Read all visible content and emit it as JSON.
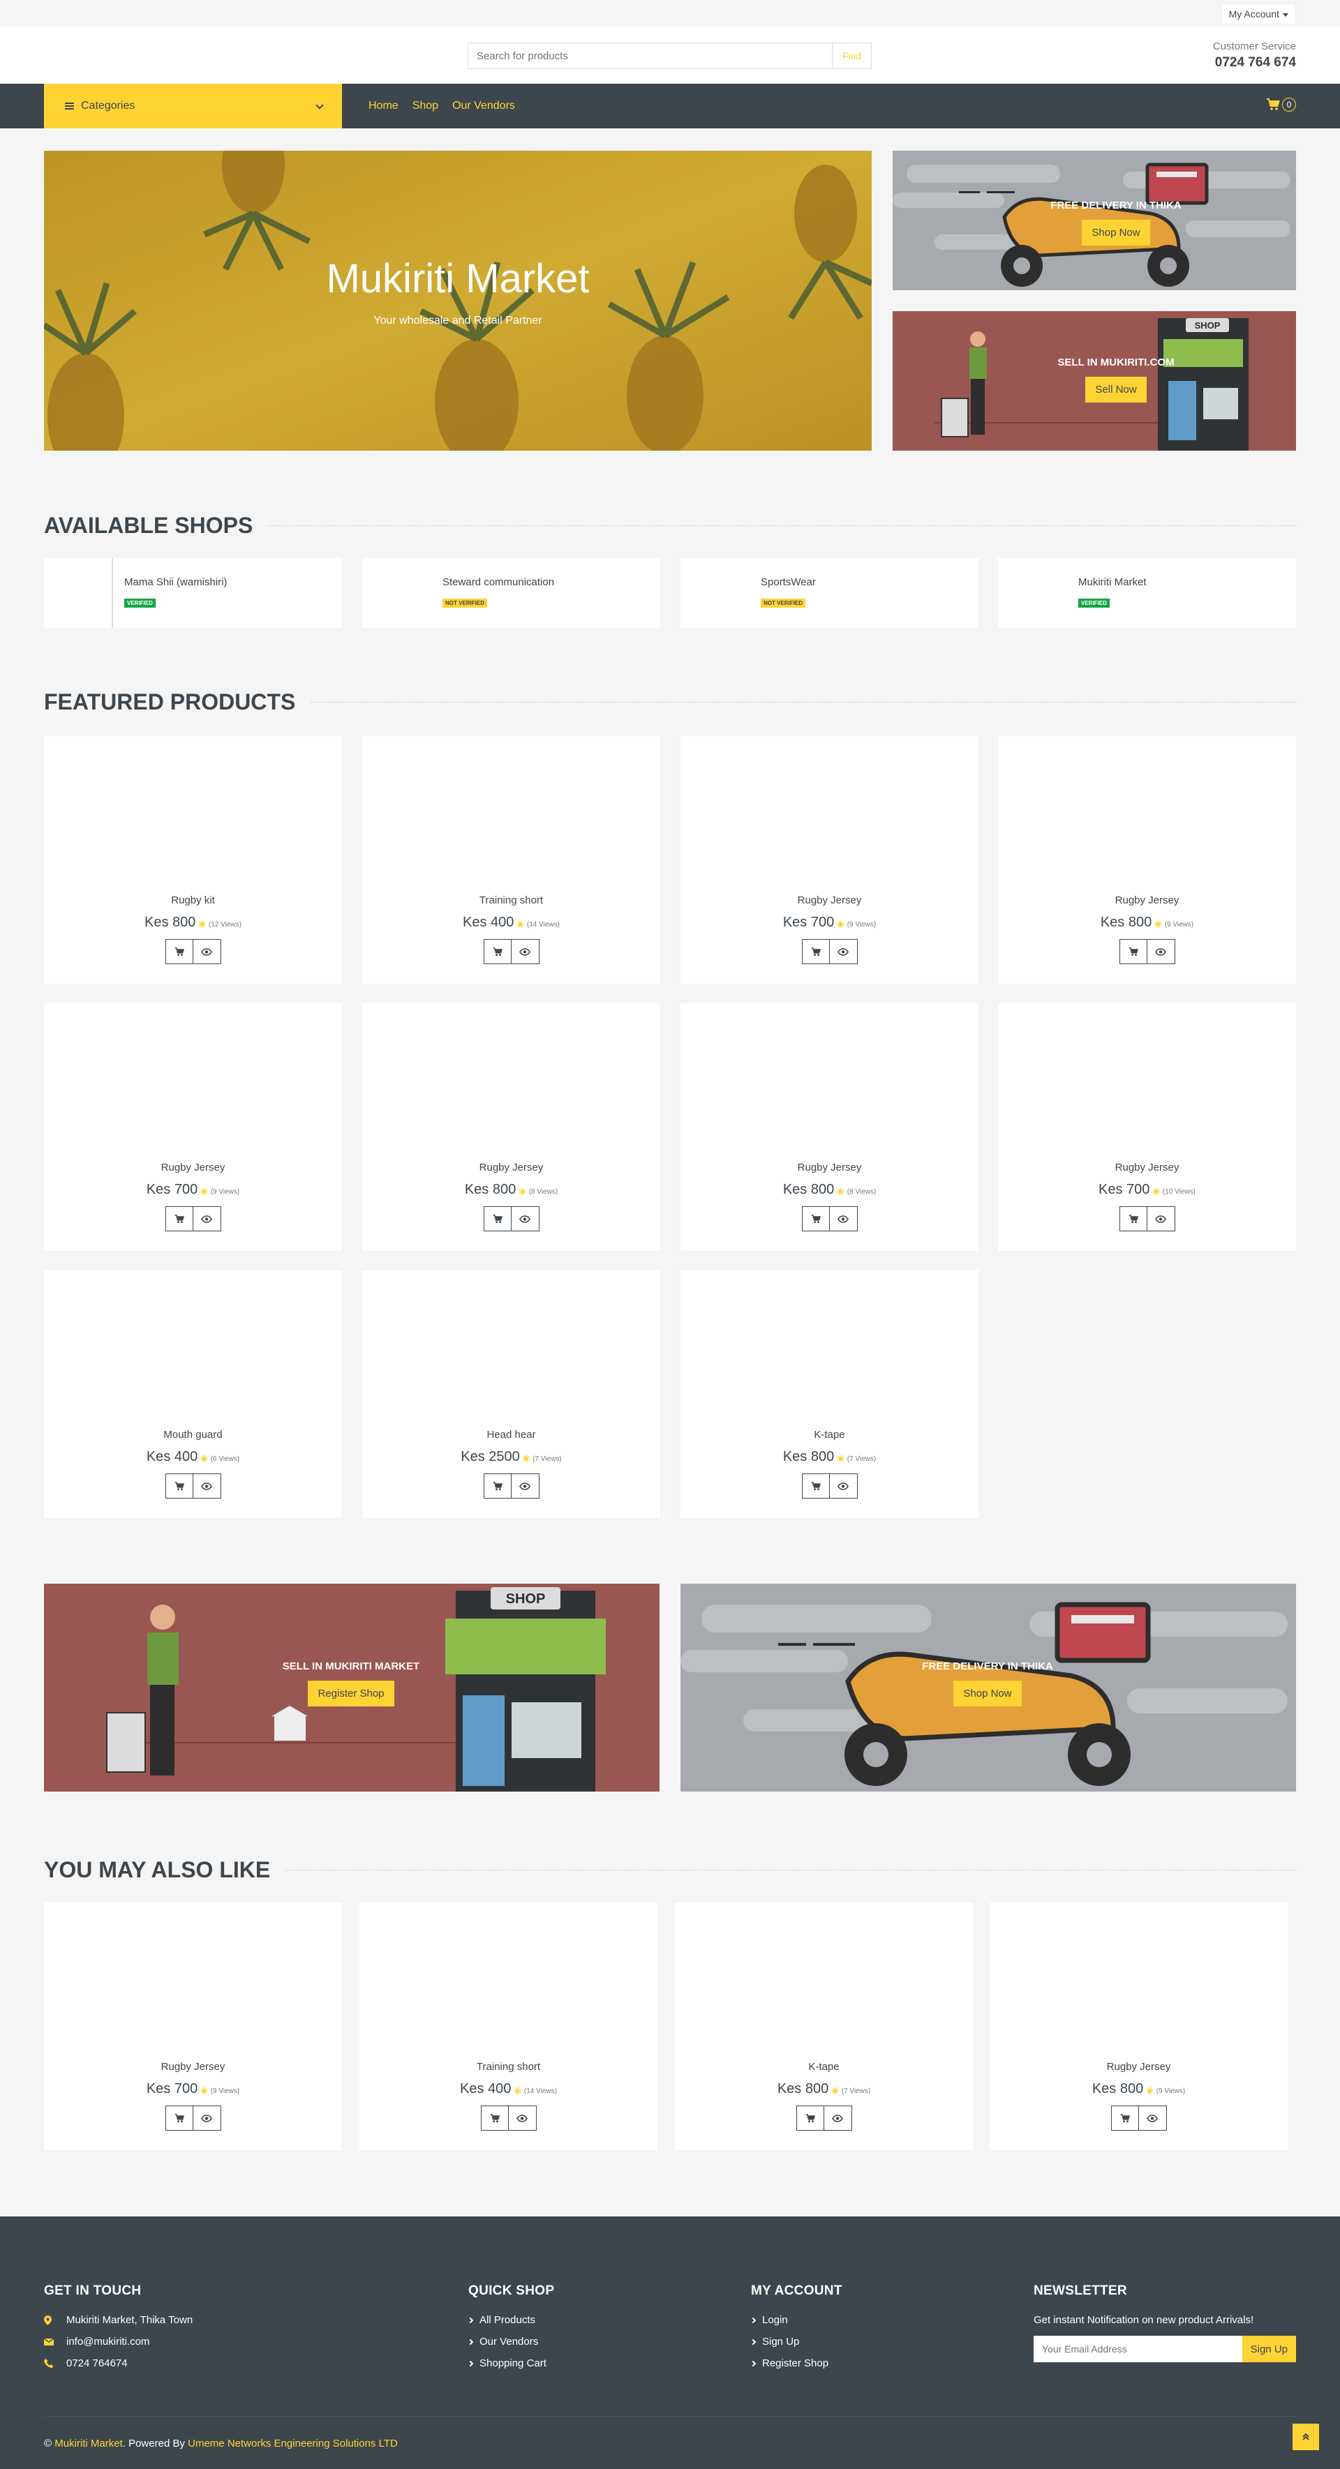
{
  "topbar": {
    "account_label": "My Account"
  },
  "header": {
    "search_placeholder": "Search for products",
    "search_button": "Find",
    "cs_label": "Customer Service",
    "cs_phone": "0724 764 674"
  },
  "nav": {
    "categories_label": "Categories",
    "links": [
      "Home",
      "Shop",
      "Our Vendors"
    ],
    "cart_count": "0"
  },
  "hero": {
    "title": "Mukiriti Market",
    "subtitle": "Your wholesale and Retail Partner"
  },
  "promos": [
    {
      "title": "FREE DELIVERY IN THIKA",
      "button": "Shop Now"
    },
    {
      "title": "SELL IN MUKIRITI.COM",
      "button": "Sell Now"
    }
  ],
  "shops_section": {
    "title": "AVAILABLE SHOPS",
    "shops": [
      {
        "name": "Mama Shii (wamishiri)",
        "status": "VERIFIED"
      },
      {
        "name": "Steward communication",
        "status": "NOT VERIFIED"
      },
      {
        "name": "SportsWear",
        "status": "NOT VERIFIED"
      },
      {
        "name": "Mukiriti Market",
        "status": "VERIFIED"
      }
    ]
  },
  "featured": {
    "title": "FEATURED PRODUCTS",
    "products": [
      {
        "name": "Rugby kit",
        "price": "Kes 800",
        "views": "(12 Views)"
      },
      {
        "name": "Training short",
        "price": "Kes 400",
        "views": "(14 Views)"
      },
      {
        "name": "Rugby Jersey",
        "price": "Kes 700",
        "views": "(9 Views)"
      },
      {
        "name": "Rugby Jersey",
        "price": "Kes 800",
        "views": "(9 Views)"
      },
      {
        "name": "Rugby Jersey",
        "price": "Kes 700",
        "views": "(9 Views)"
      },
      {
        "name": "Rugby Jersey",
        "price": "Kes 800",
        "views": "(8 Views)"
      },
      {
        "name": "Rugby Jersey",
        "price": "Kes 800",
        "views": "(8 Views)"
      },
      {
        "name": "Rugby Jersey",
        "price": "Kes 700",
        "views": "(10 Views)"
      },
      {
        "name": "Mouth guard",
        "price": "Kes 400",
        "views": "(6 Views)"
      },
      {
        "name": "Head hear",
        "price": "Kes 2500",
        "views": "(7 Views)"
      },
      {
        "name": "K-tape",
        "price": "Kes 800",
        "views": "(7 Views)"
      }
    ]
  },
  "banners": [
    {
      "title": "SELL IN MUKIRITI MARKET",
      "button": "Register Shop",
      "sign": "SHOP"
    },
    {
      "title": "FREE DELIVERY IN THIKA",
      "button": "Shop Now"
    }
  ],
  "promo_shop_sign": "SHOP",
  "also_like": {
    "title": "YOU MAY ALSO LIKE",
    "products": [
      {
        "name": "Rugby Jersey",
        "price": "Kes 700",
        "views": "(9 Views)"
      },
      {
        "name": "Training short",
        "price": "Kes 400",
        "views": "(14 Views)"
      },
      {
        "name": "K-tape",
        "price": "Kes 800",
        "views": "(7 Views)"
      },
      {
        "name": "Rugby Jersey",
        "price": "Kes 800",
        "views": "(9 Views)"
      }
    ]
  },
  "footer": {
    "contact_title": "GET IN TOUCH",
    "address": "Mukiriti Market, Thika Town",
    "email": "info@mukiriti.com",
    "phone": "0724 764674",
    "quick_title": "QUICK SHOP",
    "quick_links": [
      "All Products",
      "Our Vendors",
      "Shopping Cart"
    ],
    "account_title": "MY ACCOUNT",
    "account_links": [
      "Login",
      "Sign Up",
      "Register Shop"
    ],
    "newsletter_title": "NEWSLETTER",
    "newsletter_text": "Get instant Notification on new product Arrivals!",
    "newsletter_placeholder": "Your Email Address",
    "newsletter_button": "Sign Up",
    "copyright_symbol": "©",
    "copyright_brand": "Mukiriti Market",
    "powered_by": ". Powered By ",
    "powered_company": "Umeme Networks Engineering Solutions LTD"
  },
  "colors": {
    "accent": "#FFD333",
    "dark": "#3D464D",
    "verified": "#19A347",
    "banner_red": "#9A5751",
    "banner_grey": "#A6A9AE"
  }
}
